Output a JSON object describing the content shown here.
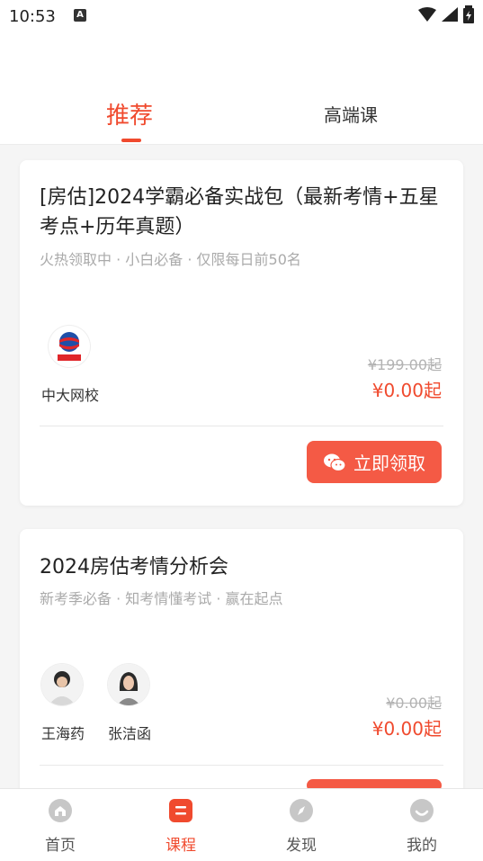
{
  "status": {
    "time": "10:53",
    "badge": "A"
  },
  "tabs": [
    {
      "label": "推荐",
      "active": true
    },
    {
      "label": "高端课",
      "active": false
    }
  ],
  "cards": [
    {
      "title": "[房估]2024学霸必备实战包（最新考情+五星考点+历年真题）",
      "subtitle": "火热领取中 · 小白必备 · 仅限每日前50名",
      "institution": "中大网校",
      "logo_text": "中大网校",
      "price_original": "¥199.00起",
      "price_current": "¥0.00起",
      "cta_label": "立即领取"
    },
    {
      "title": "2024房估考情分析会",
      "subtitle": "新考季必备 · 知考情懂考试 · 赢在起点",
      "teachers": [
        "王海药",
        "张洁函"
      ],
      "price_original": "¥0.00起",
      "price_current": "¥0.00起"
    }
  ],
  "bottom_nav": [
    {
      "label": "首页",
      "icon": "home-icon",
      "active": false
    },
    {
      "label": "课程",
      "icon": "course-icon",
      "active": true
    },
    {
      "label": "发现",
      "icon": "compass-icon",
      "active": false
    },
    {
      "label": "我的",
      "icon": "profile-icon",
      "active": false
    }
  ],
  "colors": {
    "accent": "#f04a2e",
    "cta": "#f45a45"
  }
}
